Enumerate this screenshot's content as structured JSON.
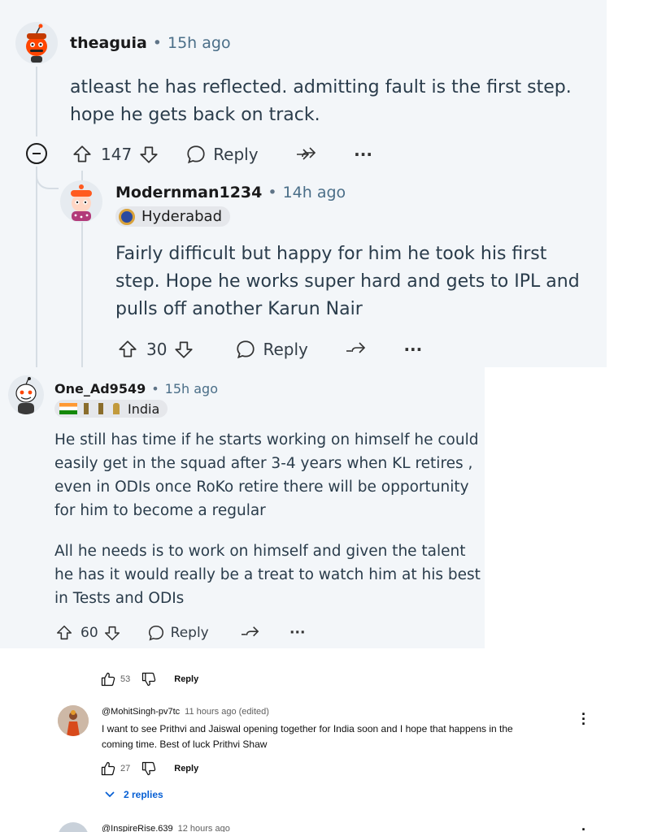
{
  "comments": [
    {
      "username": "theaguia",
      "timestamp": "15h ago",
      "body": [
        "atleast he has reflected. admitting fault is the first step.",
        "hope he gets back on track."
      ],
      "score": "147",
      "reply_label": "Reply"
    },
    {
      "username": "Modernman1234",
      "timestamp": "14h ago",
      "flair": "Hyderabad",
      "body": [
        "Fairly difficult but happy for him he took his first",
        "step. Hope he works super hard and gets to IPL and",
        "pulls off another Karun Nair"
      ],
      "score": "30",
      "reply_label": "Reply"
    },
    {
      "username": "One_Ad9549",
      "timestamp": "15h ago",
      "flair": "India",
      "body": [
        "He still has time if he starts working on himself he could",
        "easily get in the squad after 3-4 years when KL retires ,",
        "even in ODIs once RoKo retire there will be opportunity",
        "for him to become a regular"
      ],
      "body2": [
        "All he needs is to work on himself and given the talent",
        "he has it would really be a treat to watch him at his best",
        "in Tests and ODIs"
      ],
      "score": "60",
      "reply_label": "Reply"
    }
  ],
  "youtube": {
    "top_likes": "53",
    "reply_label": "Reply",
    "comment": {
      "handle": "@MohitSingh-pv7tc",
      "timestamp": "11 hours ago (edited)",
      "body": [
        "I want to see Prithvi and Jaiswal opening together for India soon and I hope that happens in the",
        "coming time. Best of luck Prithvi Shaw"
      ],
      "likes": "27",
      "replies_label": "2 replies"
    },
    "next": {
      "handle": "@InspireRise.639",
      "timestamp": "12 hours ago"
    }
  },
  "colors": {
    "panel_bg": "#f3f6f9",
    "timestamp": "#4a6e88",
    "youtube_link": "#065fd4"
  }
}
